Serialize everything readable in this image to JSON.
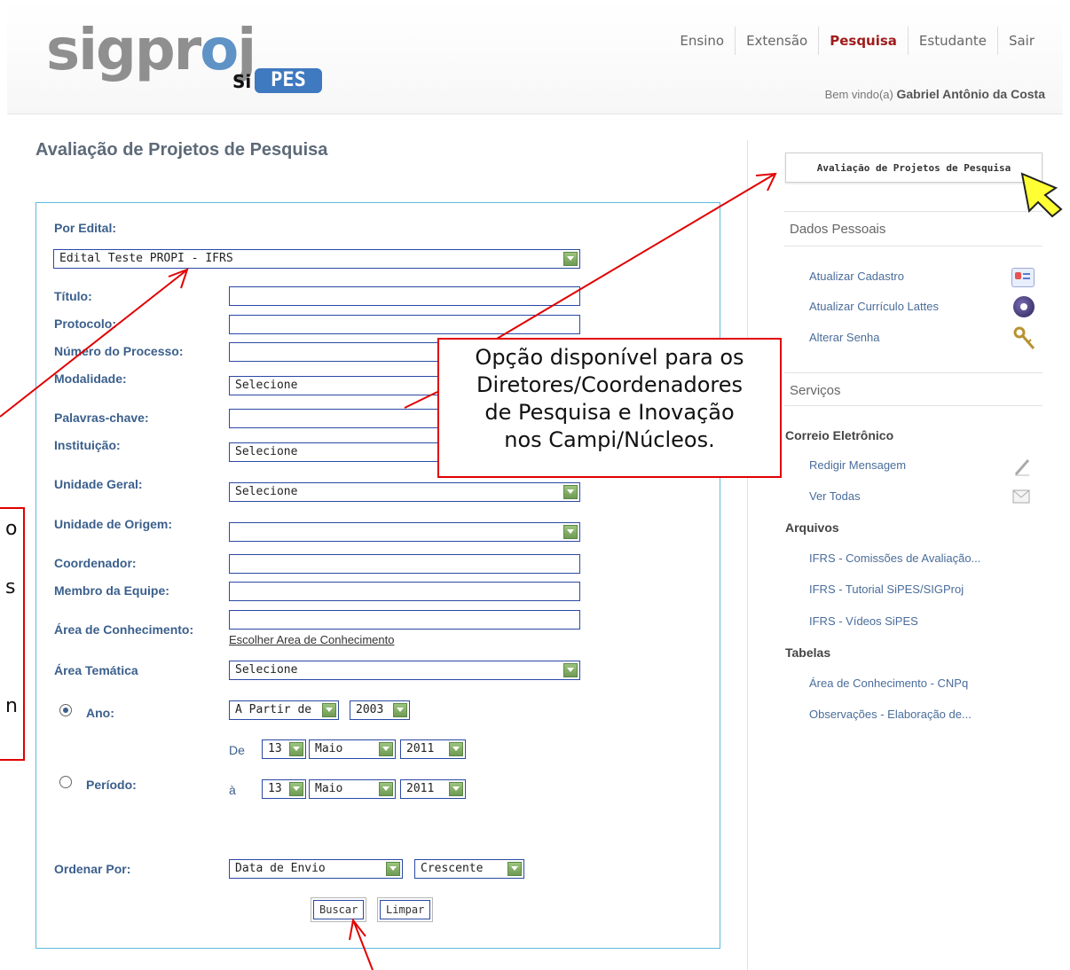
{
  "header": {
    "logo_main": "sigproj",
    "logo_si": "Si",
    "logo_pes": "PES",
    "nav": [
      {
        "label": "Ensino",
        "active": false
      },
      {
        "label": "Extensão",
        "active": false
      },
      {
        "label": "Pesquisa",
        "active": true
      },
      {
        "label": "Estudante",
        "active": false
      },
      {
        "label": "Sair",
        "active": false
      }
    ],
    "welcome_prefix": "Bem vindo(a)",
    "welcome_user": "Gabriel Antônio da Costa"
  },
  "page_title": "Avaliação de Projetos de Pesquisa",
  "form": {
    "edital_label": "Por Edital:",
    "edital_value": "Edital Teste PROPI - IFRS",
    "titulo_label": "Título:",
    "protocolo_label": "Protocolo:",
    "processo_label": "Número do Processo:",
    "modalidade_label": "Modalidade:",
    "modalidade_value": "Selecione",
    "palavras_label": "Palavras-chave:",
    "instituicao_label": "Instituição:",
    "instituicao_value": "Selecione",
    "unidade_geral_label": "Unidade Geral:",
    "unidade_geral_value": "Selecione",
    "unidade_origem_label": "Unidade de Origem:",
    "unidade_origem_value": "",
    "coordenador_label": "Coordenador:",
    "membro_label": "Membro da Equipe:",
    "area_conhecimento_label": "Área de Conhecimento:",
    "area_conhecimento_link": "Escolher Area de Conhecimento",
    "area_tematica_label": "Área Temática",
    "area_tematica_value": "Selecione",
    "ano_label": "Ano:",
    "ano_mode": "A Partir de",
    "ano_value": "2003",
    "periodo_label": "Período:",
    "de_label": "De",
    "ate_label": "à",
    "de_day": "13",
    "de_month": "Maio",
    "de_year": "2011",
    "ate_day": "13",
    "ate_month": "Maio",
    "ate_year": "2011",
    "ordenar_label": "Ordenar Por:",
    "ordenar_value": "Data de Envio",
    "ordem_value": "Crescente",
    "buscar_label": "Buscar",
    "limpar_label": "Limpar"
  },
  "sidebar": {
    "top_button": "Avaliação de Projetos de Pesquisa",
    "dados_pessoais": "Dados Pessoais",
    "atualizar_cadastro": "Atualizar Cadastro",
    "atualizar_lattes": "Atualizar Currículo Lattes",
    "alterar_senha": "Alterar Senha",
    "servicos": "Serviços",
    "correio": "Correio Eletrônico",
    "redigir": "Redigir Mensagem",
    "ver_todas": "Ver Todas",
    "arquivos": "Arquivos",
    "arq1": "IFRS - Comissões de Avaliação...",
    "arq2": "IFRS - Tutorial SiPES/SIGProj",
    "arq3": "IFRS - Vídeos SiPES",
    "tabelas": "Tabelas",
    "tab1": "Área de Conhecimento - CNPq",
    "tab2": "Observações - Elaboração de..."
  },
  "callout_right": {
    "line1": "Opção disponível para os",
    "line2": "Diretores/Coordenadores",
    "line3": "de Pesquisa e Inovação",
    "line4": "nos Campi/Núcleos."
  },
  "callout_left": {
    "c1": "o",
    "c2": "s",
    "c3": "n"
  },
  "colors": {
    "accent_nav_active": "#a01c1c",
    "label_blue": "#3b5f8c",
    "form_border": "#5dbadd",
    "annotation_red": "#e10000",
    "pointer_yellow": "#ffff33"
  }
}
